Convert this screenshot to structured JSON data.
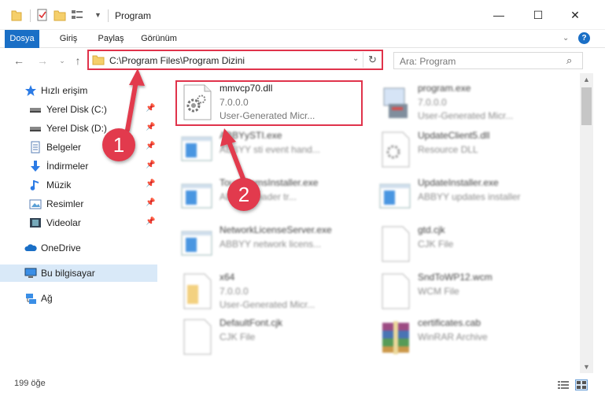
{
  "window": {
    "title": "Program",
    "minimize_glyph": "—",
    "maximize_glyph": "☐",
    "close_glyph": "✕"
  },
  "ribbon": {
    "tabs": [
      "Dosya",
      "Giriş",
      "Paylaş",
      "Görünüm"
    ],
    "accent": "#1a6fc6"
  },
  "address": {
    "path": "C:\\Program Files\\Program Dizini",
    "search_placeholder": "Ara: Program",
    "highlight_color": "#e0334b"
  },
  "nav": {
    "items": [
      {
        "label": "Hızlı erişim",
        "icon": "star-icon"
      },
      {
        "label": "Yerel Disk (C:)",
        "icon": "drive-icon",
        "pinned": true
      },
      {
        "label": "Yerel Disk (D:)",
        "icon": "drive-icon",
        "pinned": true
      },
      {
        "label": "Belgeler",
        "icon": "documents-icon",
        "pinned": true
      },
      {
        "label": "İndirmeler",
        "icon": "download-icon",
        "pinned": true
      },
      {
        "label": "Müzik",
        "icon": "music-icon",
        "pinned": true
      },
      {
        "label": "Resimler",
        "icon": "pictures-icon",
        "pinned": true
      },
      {
        "label": "Videolar",
        "icon": "videos-icon",
        "pinned": true
      },
      {
        "label": "OneDrive",
        "icon": "cloud-icon"
      },
      {
        "label": "Bu bilgisayar",
        "icon": "computer-icon",
        "selected": true
      },
      {
        "label": "Ağ",
        "icon": "network-icon"
      }
    ]
  },
  "files": [
    {
      "name": "mmvcp70.dll",
      "line2": "7.0.0.0",
      "line3": "User-Generated Micr...",
      "icon": "dll-gear-icon",
      "highlighted": true
    },
    {
      "name": "program.exe",
      "line2": "7.0.0.0",
      "line3": "User-Generated Micr...",
      "icon": "exe-icon"
    },
    {
      "name": "ABBYySTI.exe",
      "line2": "ABBYY sti event hand...",
      "line3": "",
      "icon": "app-window-icon"
    },
    {
      "name": "UpdateClient5.dll",
      "line2": "Resource DLL",
      "line3": "",
      "icon": "dll-gear-icon"
    },
    {
      "name": "TouchItemsInstaller.exe",
      "line2": "ABBYY reader tr...",
      "line3": "",
      "icon": "app-window-icon"
    },
    {
      "name": "UpdateInstaller.exe",
      "line2": "ABBYY updates installer",
      "line3": "",
      "icon": "app-window-icon"
    },
    {
      "name": "NetworkLicenseServer.exe",
      "line2": "ABBYY network licens...",
      "line3": "",
      "icon": "app-window-icon"
    },
    {
      "name": "gtd.cjk",
      "line2": "CJK File",
      "line3": "",
      "icon": "blank-file-icon"
    },
    {
      "name": "x64",
      "line2": "7.0.0.0",
      "line3": "User-Generated Micr...",
      "icon": "folder-file-icon"
    },
    {
      "name": "SndToWP12.wcm",
      "line2": "WCM File",
      "line3": "",
      "icon": "blank-file-icon"
    },
    {
      "name": "DefaultFont.cjk",
      "line2": "CJK File",
      "line3": "",
      "icon": "blank-file-icon"
    },
    {
      "name": "certificates.cab",
      "line2": "WinRAR Archive",
      "line3": "",
      "icon": "archive-icon"
    }
  ],
  "status": {
    "count": "199 öğe"
  },
  "annotations": {
    "marker1": "1",
    "marker2": "2",
    "color": "#e23a4d"
  }
}
